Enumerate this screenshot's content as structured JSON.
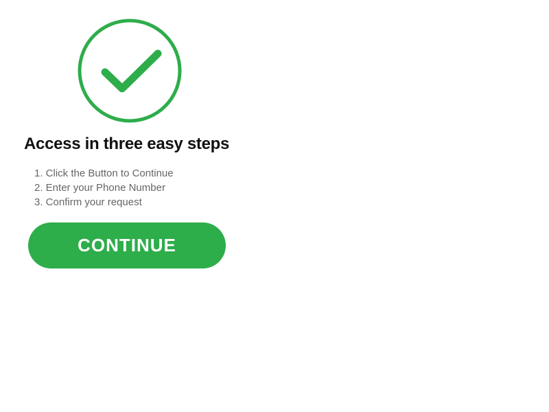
{
  "success_icon": {
    "name": "check-circle-icon",
    "color": "#2ead4b"
  },
  "headline": "Access in three easy steps",
  "steps": [
    "1. Click the Button to Continue",
    "2. Enter your Phone Number",
    "3. Confirm your request"
  ],
  "continue_button": {
    "label": "CONTINUE",
    "color": "#2ead4b",
    "text_color": "#ffffff"
  }
}
